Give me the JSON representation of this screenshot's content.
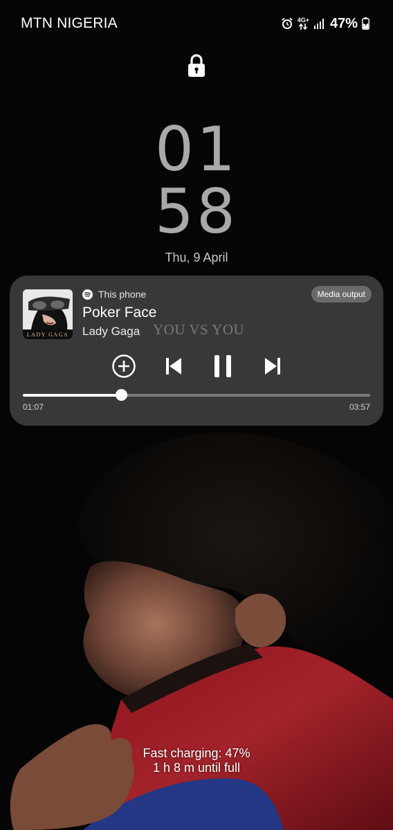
{
  "status_bar": {
    "carrier": "MTN NIGERIA",
    "network_type": "4G+",
    "battery_percent": "47%",
    "icons": [
      "alarm-icon",
      "network-icon",
      "signal-icon",
      "battery-charging-icon"
    ]
  },
  "lock": {
    "icon": "lock-icon"
  },
  "clock": {
    "hours": "01",
    "minutes": "58",
    "date": "Thu, 9 April"
  },
  "media": {
    "source": "This phone",
    "source_icon": "spotify-icon",
    "output_button": "Media output",
    "title": "Poker Face",
    "artist": "Lady Gaga",
    "album_art_text": "LADY GAGA",
    "watermark": "YOU VS YOU",
    "controls": [
      "add-icon",
      "previous-icon",
      "pause-icon",
      "next-icon"
    ],
    "elapsed": "01:07",
    "duration": "03:57",
    "progress": 0.283
  },
  "charging": {
    "line1": "Fast charging: 47%",
    "line2": "1 h 8 m until full"
  },
  "colors": {
    "card_background": "#3a3a3a",
    "clock_color": "#a9a9a9",
    "jersey_red": "#a21a22",
    "jersey_blue": "#243a8c"
  }
}
